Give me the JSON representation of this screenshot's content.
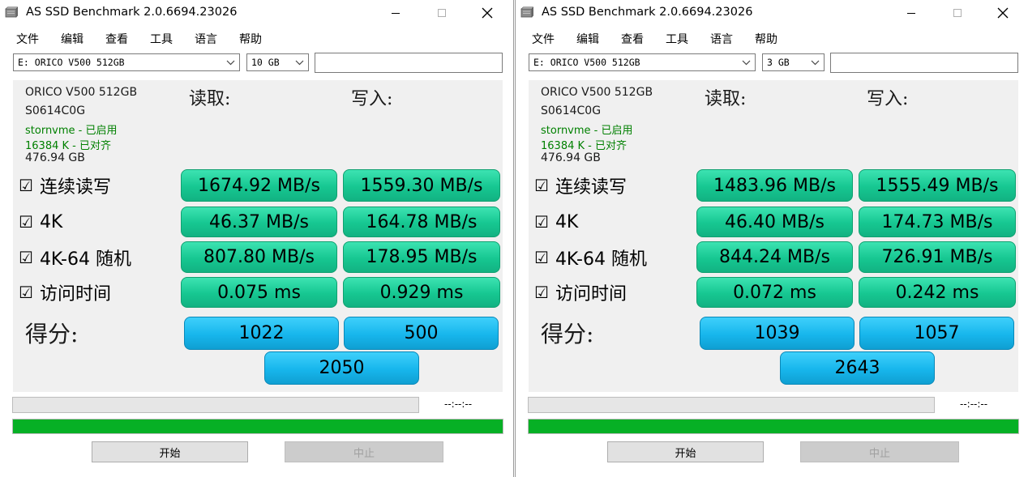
{
  "windows": [
    {
      "title": "AS SSD Benchmark 2.0.6694.23026",
      "menu": [
        "文件",
        "编辑",
        "查看",
        "工具",
        "语言",
        "帮助"
      ],
      "drive_select": "E: ORICO V500 512GB",
      "size_select": "10 GB",
      "drive_info": {
        "model": "ORICO V500 512GB",
        "firmware": "S0614C0G",
        "driver": "stornvme - 已启用",
        "alignment": "16384 K - 已对齐",
        "capacity": "476.94 GB"
      },
      "read_header": "读取:",
      "write_header": "写入:",
      "rows": [
        {
          "label": "连续读写",
          "read": "1674.92 MB/s",
          "write": "1559.30 MB/s"
        },
        {
          "label": "4K",
          "read": "46.37 MB/s",
          "write": "164.78 MB/s"
        },
        {
          "label": "4K-64 随机",
          "read": "807.80 MB/s",
          "write": "178.95 MB/s"
        },
        {
          "label": "访问时间",
          "read": "0.075 ms",
          "write": "0.929 ms"
        }
      ],
      "score_label": "得分:",
      "score_read": "1022",
      "score_write": "500",
      "score_total": "2050",
      "time": "--:--:--",
      "progress": 1.0,
      "start_label": "开始",
      "stop_label": "中止"
    },
    {
      "title": "AS SSD Benchmark 2.0.6694.23026",
      "menu": [
        "文件",
        "编辑",
        "查看",
        "工具",
        "语言",
        "帮助"
      ],
      "drive_select": "E: ORICO V500 512GB",
      "size_select": "3 GB",
      "drive_info": {
        "model": "ORICO V500 512GB",
        "firmware": "S0614C0G",
        "driver": "stornvme - 已启用",
        "alignment": "16384 K - 已对齐",
        "capacity": "476.94 GB"
      },
      "read_header": "读取:",
      "write_header": "写入:",
      "rows": [
        {
          "label": "连续读写",
          "read": "1483.96 MB/s",
          "write": "1555.49 MB/s"
        },
        {
          "label": "4K",
          "read": "46.40 MB/s",
          "write": "174.73 MB/s"
        },
        {
          "label": "4K-64 随机",
          "read": "844.24 MB/s",
          "write": "726.91 MB/s"
        },
        {
          "label": "访问时间",
          "read": "0.072 ms",
          "write": "0.242 ms"
        }
      ],
      "score_label": "得分:",
      "score_read": "1039",
      "score_write": "1057",
      "score_total": "2643",
      "time": "--:--:--",
      "progress": 1.0,
      "start_label": "开始",
      "stop_label": "中止"
    }
  ],
  "colors": {
    "result_green": "#16c791",
    "score_blue": "#17b6ec",
    "progress_green": "#06b025"
  },
  "icons": {
    "app": "drive-icon",
    "checkbox": "checked-checkbox-icon"
  }
}
